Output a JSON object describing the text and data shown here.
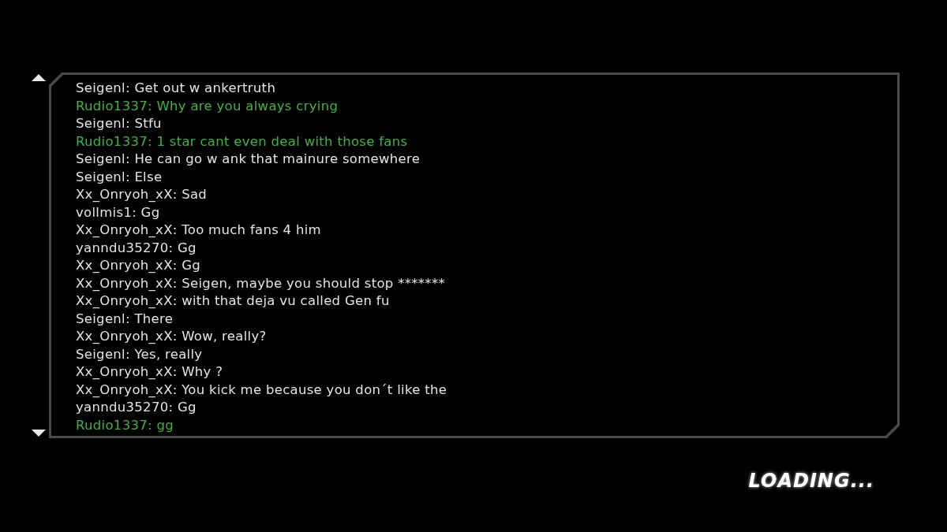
{
  "chat": {
    "messages": [
      {
        "text": "Seigenl: Get out w ankertruth",
        "color": "#e4e4e4"
      },
      {
        "text": "Rudio1337: Why are you always crying",
        "color": "#3db53d"
      },
      {
        "text": "Seigenl: Stfu",
        "color": "#e4e4e4"
      },
      {
        "text": "Rudio1337: 1 star cant even deal with those fans",
        "color": "#3db53d"
      },
      {
        "text": "Seigenl: He can go w ank that mainure somewhere",
        "color": "#e4e4e4"
      },
      {
        "text": "Seigenl: Else",
        "color": "#e4e4e4"
      },
      {
        "text": "Xx_Onryoh_xX: Sad",
        "color": "#e4e4e4"
      },
      {
        "text": "vollmis1: Gg",
        "color": "#e4e4e4"
      },
      {
        "text": "Xx_Onryoh_xX: Too much fans 4 him",
        "color": "#e4e4e4"
      },
      {
        "text": "yanndu35270: Gg",
        "color": "#e4e4e4"
      },
      {
        "text": "Xx_Onryoh_xX: Gg",
        "color": "#e4e4e4"
      },
      {
        "text": "Xx_Onryoh_xX: Seigen, maybe you should stop *******",
        "color": "#e4e4e4"
      },
      {
        "text": "Xx_Onryoh_xX: with that deja vu called Gen fu",
        "color": "#e4e4e4"
      },
      {
        "text": "Seigenl: There",
        "color": "#e4e4e4"
      },
      {
        "text": "Xx_Onryoh_xX: Wow, really?",
        "color": "#e4e4e4"
      },
      {
        "text": "Seigenl: Yes, really",
        "color": "#e4e4e4"
      },
      {
        "text": "Xx_Onryoh_xX: Why ?",
        "color": "#e4e4e4"
      },
      {
        "text": "Xx_Onryoh_xX: You kick me because you don´t like the",
        "color": "#e4e4e4"
      },
      {
        "text": "yanndu35270: Gg",
        "color": "#e4e4e4"
      },
      {
        "text": "Rudio1337: gg",
        "color": "#3db53d"
      }
    ]
  },
  "loading": {
    "label": "LOADING..."
  }
}
